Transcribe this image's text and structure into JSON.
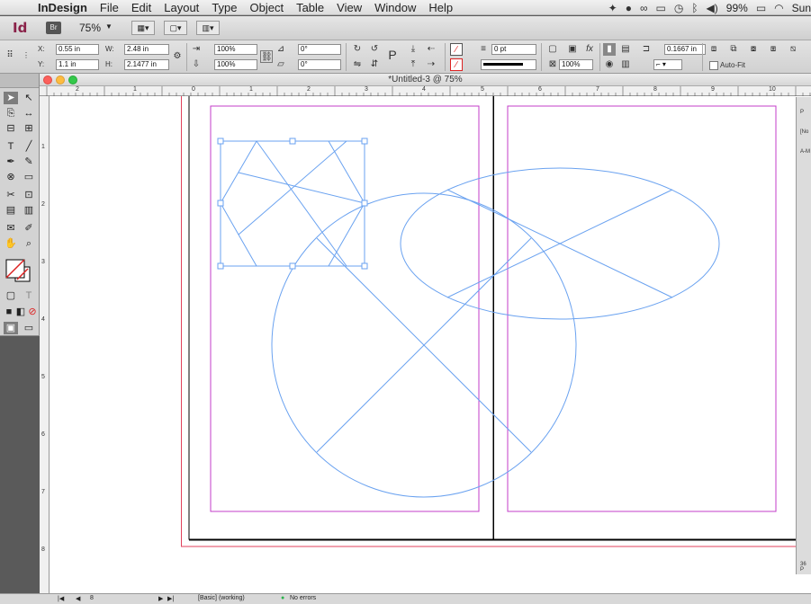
{
  "menubar": {
    "app_name": "InDesign",
    "items": [
      "File",
      "Edit",
      "Layout",
      "Type",
      "Object",
      "Table",
      "View",
      "Window",
      "Help"
    ],
    "battery": "99%",
    "clock": "Sun"
  },
  "appbar": {
    "logo": "Id",
    "bridge": "Br",
    "zoom": "75%"
  },
  "control": {
    "x_label": "X:",
    "x_value": "0.55 in",
    "y_label": "Y:",
    "y_value": "1.1 in",
    "w_label": "W:",
    "w_value": "2.48 in",
    "h_label": "H:",
    "h_value": "2.1477 in",
    "scale_x": "100%",
    "scale_y": "100%",
    "rotate": "0°",
    "shear": "0°",
    "stroke_weight": "0 pt",
    "opacity": "100%",
    "offset": "0.1667 in",
    "autofit": "Auto-Fit"
  },
  "document": {
    "title": "*Untitled-3 @ 75%",
    "hruler_labels": [
      "2",
      "1",
      "0",
      "1",
      "2",
      "3",
      "4",
      "5",
      "6",
      "7",
      "8",
      "9",
      "10"
    ],
    "vruler_labels": [
      "1",
      "2",
      "3",
      "4",
      "5",
      "6",
      "7",
      "8"
    ]
  },
  "rpanel": {
    "t1": "P",
    "t2": "[No",
    "t3": "A-M",
    "t4": "36 P"
  },
  "status": {
    "page": "8",
    "master": "[Basic] (working)",
    "errors": "No errors"
  },
  "colors": {
    "frame": "#6aa2f0",
    "margin": "#c33cc8",
    "bleed": "#e0415b",
    "accent_logo": "#8a2249",
    "preflight_ok": "#2bb24c"
  }
}
